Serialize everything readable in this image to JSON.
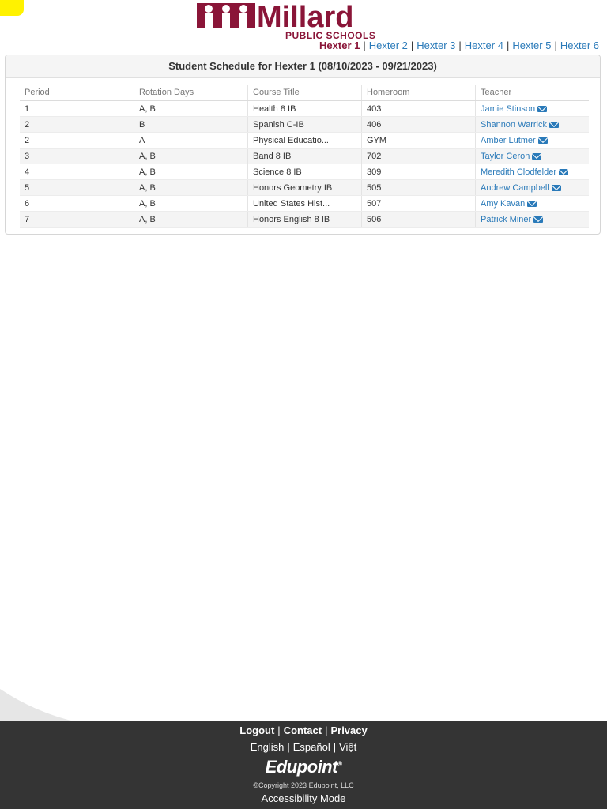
{
  "brand": {
    "logo_word": "Millard",
    "logo_sub": "PUBLIC SCHOOLS",
    "primary_color": "#8a1538",
    "link_color": "#2a7ab9"
  },
  "hexter_nav": [
    {
      "label": "Hexter 1",
      "active": true
    },
    {
      "label": "Hexter 2",
      "active": false
    },
    {
      "label": "Hexter 3",
      "active": false
    },
    {
      "label": "Hexter 4",
      "active": false
    },
    {
      "label": "Hexter 5",
      "active": false
    },
    {
      "label": "Hexter 6",
      "active": false
    }
  ],
  "schedule": {
    "title": "Student Schedule for Hexter 1 (08/10/2023 - 09/21/2023)",
    "columns": [
      "Period",
      "Rotation Days",
      "Course Title",
      "Homeroom",
      "Teacher"
    ],
    "rows": [
      {
        "period": "1",
        "rotation": "A, B",
        "course": "Health 8 IB",
        "homeroom": "403",
        "teacher": "Jamie Stinson"
      },
      {
        "period": "2",
        "rotation": "B",
        "course": "Spanish C-IB",
        "homeroom": "406",
        "teacher": "Shannon Warrick"
      },
      {
        "period": "2",
        "rotation": "A",
        "course": "Physical Educatio...",
        "homeroom": "GYM",
        "teacher": "Amber Lutmer"
      },
      {
        "period": "3",
        "rotation": "A, B",
        "course": "Band 8 IB",
        "homeroom": "702",
        "teacher": "Taylor Ceron"
      },
      {
        "period": "4",
        "rotation": "A, B",
        "course": "Science 8 IB",
        "homeroom": "309",
        "teacher": "Meredith Clodfelder"
      },
      {
        "period": "5",
        "rotation": "A, B",
        "course": "Honors Geometry IB",
        "homeroom": "505",
        "teacher": "Andrew Campbell"
      },
      {
        "period": "6",
        "rotation": "A, B",
        "course": "United States Hist...",
        "homeroom": "507",
        "teacher": "Amy Kavan"
      },
      {
        "period": "7",
        "rotation": "A, B",
        "course": "Honors English 8 IB",
        "homeroom": "506",
        "teacher": "Patrick Miner"
      }
    ]
  },
  "footer": {
    "links": [
      "Logout",
      "Contact",
      "Privacy"
    ],
    "languages": [
      "English",
      "Español",
      "Việt"
    ],
    "logo": "Edupoint",
    "logo_mark": "®",
    "copyright": "©Copyright 2023 Edupoint, LLC",
    "accessibility": "Accessibility Mode",
    "background": "#343434"
  }
}
